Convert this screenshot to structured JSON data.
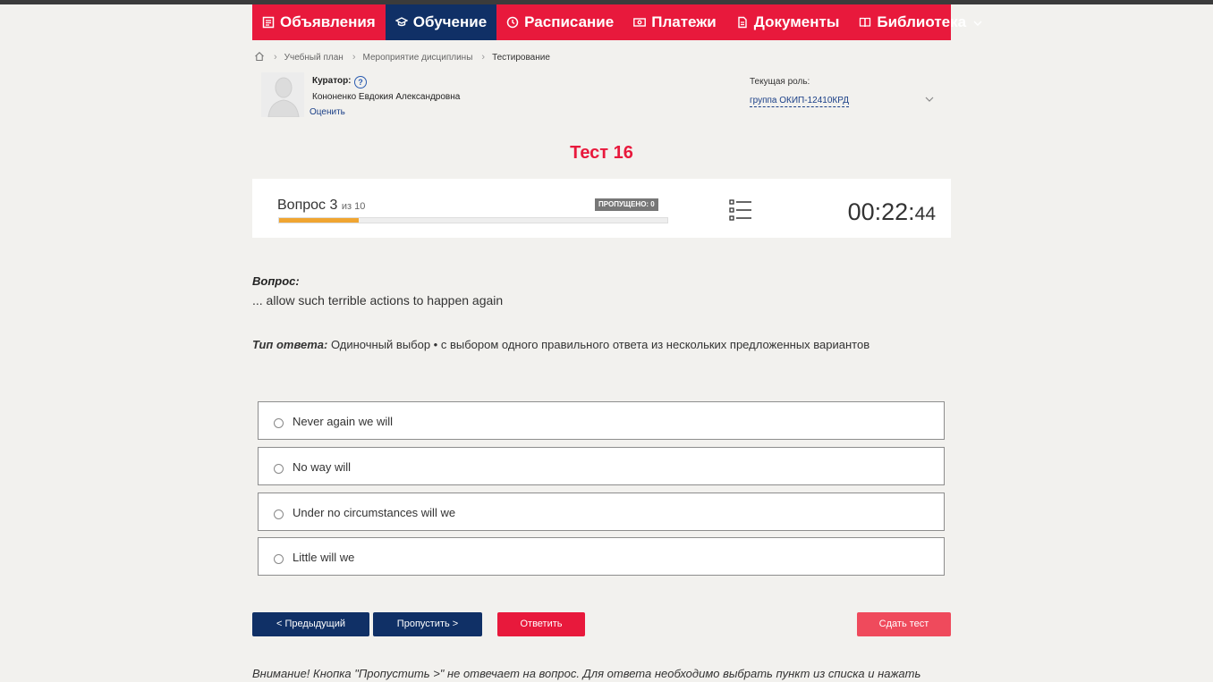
{
  "nav": {
    "items": [
      {
        "label": "Объявления",
        "icon": "announcements-icon"
      },
      {
        "label": "Обучение",
        "icon": "graduation-cap-icon",
        "active": true
      },
      {
        "label": "Расписание",
        "icon": "clock-icon"
      },
      {
        "label": "Платежи",
        "icon": "payments-icon"
      },
      {
        "label": "Документы",
        "icon": "document-icon"
      },
      {
        "label": "Библиотека",
        "icon": "book-icon",
        "has_dropdown": true
      }
    ]
  },
  "breadcrumb": {
    "items": [
      "Учебный план",
      "Мероприятие дисциплины",
      "Тестирование"
    ]
  },
  "curator": {
    "label": "Куратор:",
    "name": "Кононенко Евдокия Александровна",
    "rate_link": "Оценить"
  },
  "role": {
    "label": "Текущая роль:",
    "value": "группа ОКИП-12410КРД"
  },
  "test": {
    "title": "Тест 16"
  },
  "progress": {
    "question_label": "Вопрос 3",
    "of_label": "из 10",
    "skipped": "ПРОПУЩЕНО: 0",
    "fraction": 0.204,
    "timer_main": "00:22:",
    "timer_sec": "44"
  },
  "question": {
    "heading": "Вопрос:",
    "text": "... allow such terrible actions to happen again",
    "type_label": "Тип ответа:",
    "type_value": "Одиночный выбор • с выбором одного правильного ответа из нескольких предложенных вариантов"
  },
  "options": [
    "Never again we will",
    "No way will",
    "Under no circumstances will we",
    "Little will we"
  ],
  "buttons": {
    "prev": "< Предыдущий",
    "skip": "Пропустить >",
    "answer": "Ответить",
    "submit": "Сдать тест"
  },
  "notice": "Внимание! Кнопка \"Пропустить >\" не отвечает на вопрос. Для ответа необходимо выбрать пункт из списка и нажать",
  "colors": {
    "brand_red": "#e8193c",
    "brand_navy": "#103066",
    "progress": "#f0a531"
  }
}
